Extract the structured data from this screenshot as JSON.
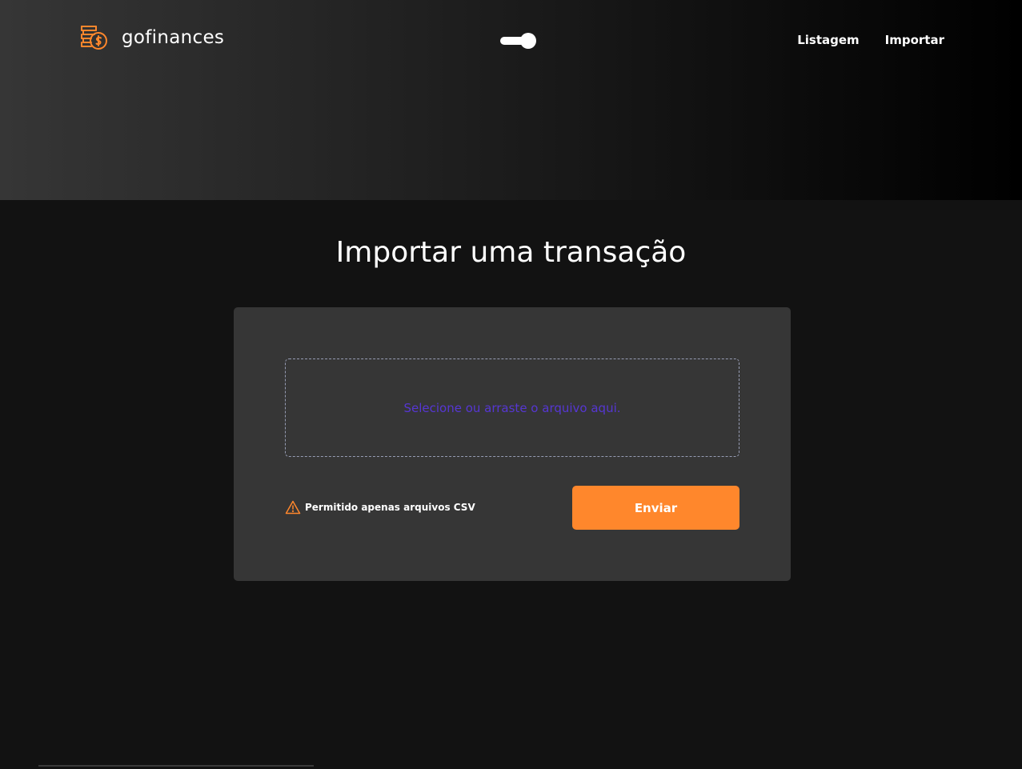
{
  "header": {
    "logo_text": "gofinances",
    "logo_icon": "coins-dollar-icon",
    "theme_toggle": {
      "state": "on"
    },
    "nav": {
      "items": [
        {
          "label": "Listagem"
        },
        {
          "label": "Importar"
        }
      ]
    }
  },
  "main": {
    "title": "Importar uma transação",
    "dropzone": {
      "text": "Selecione ou arraste o arquivo aqui."
    },
    "warning": {
      "icon": "alert-triangle-icon",
      "text": "Permitido apenas arquivos CSV"
    },
    "send_label": "Enviar"
  },
  "colors": {
    "accent_orange": "#FF872C",
    "dropzone_text": "#5636D3",
    "card_bg": "#363636",
    "page_bg": "#121212"
  }
}
